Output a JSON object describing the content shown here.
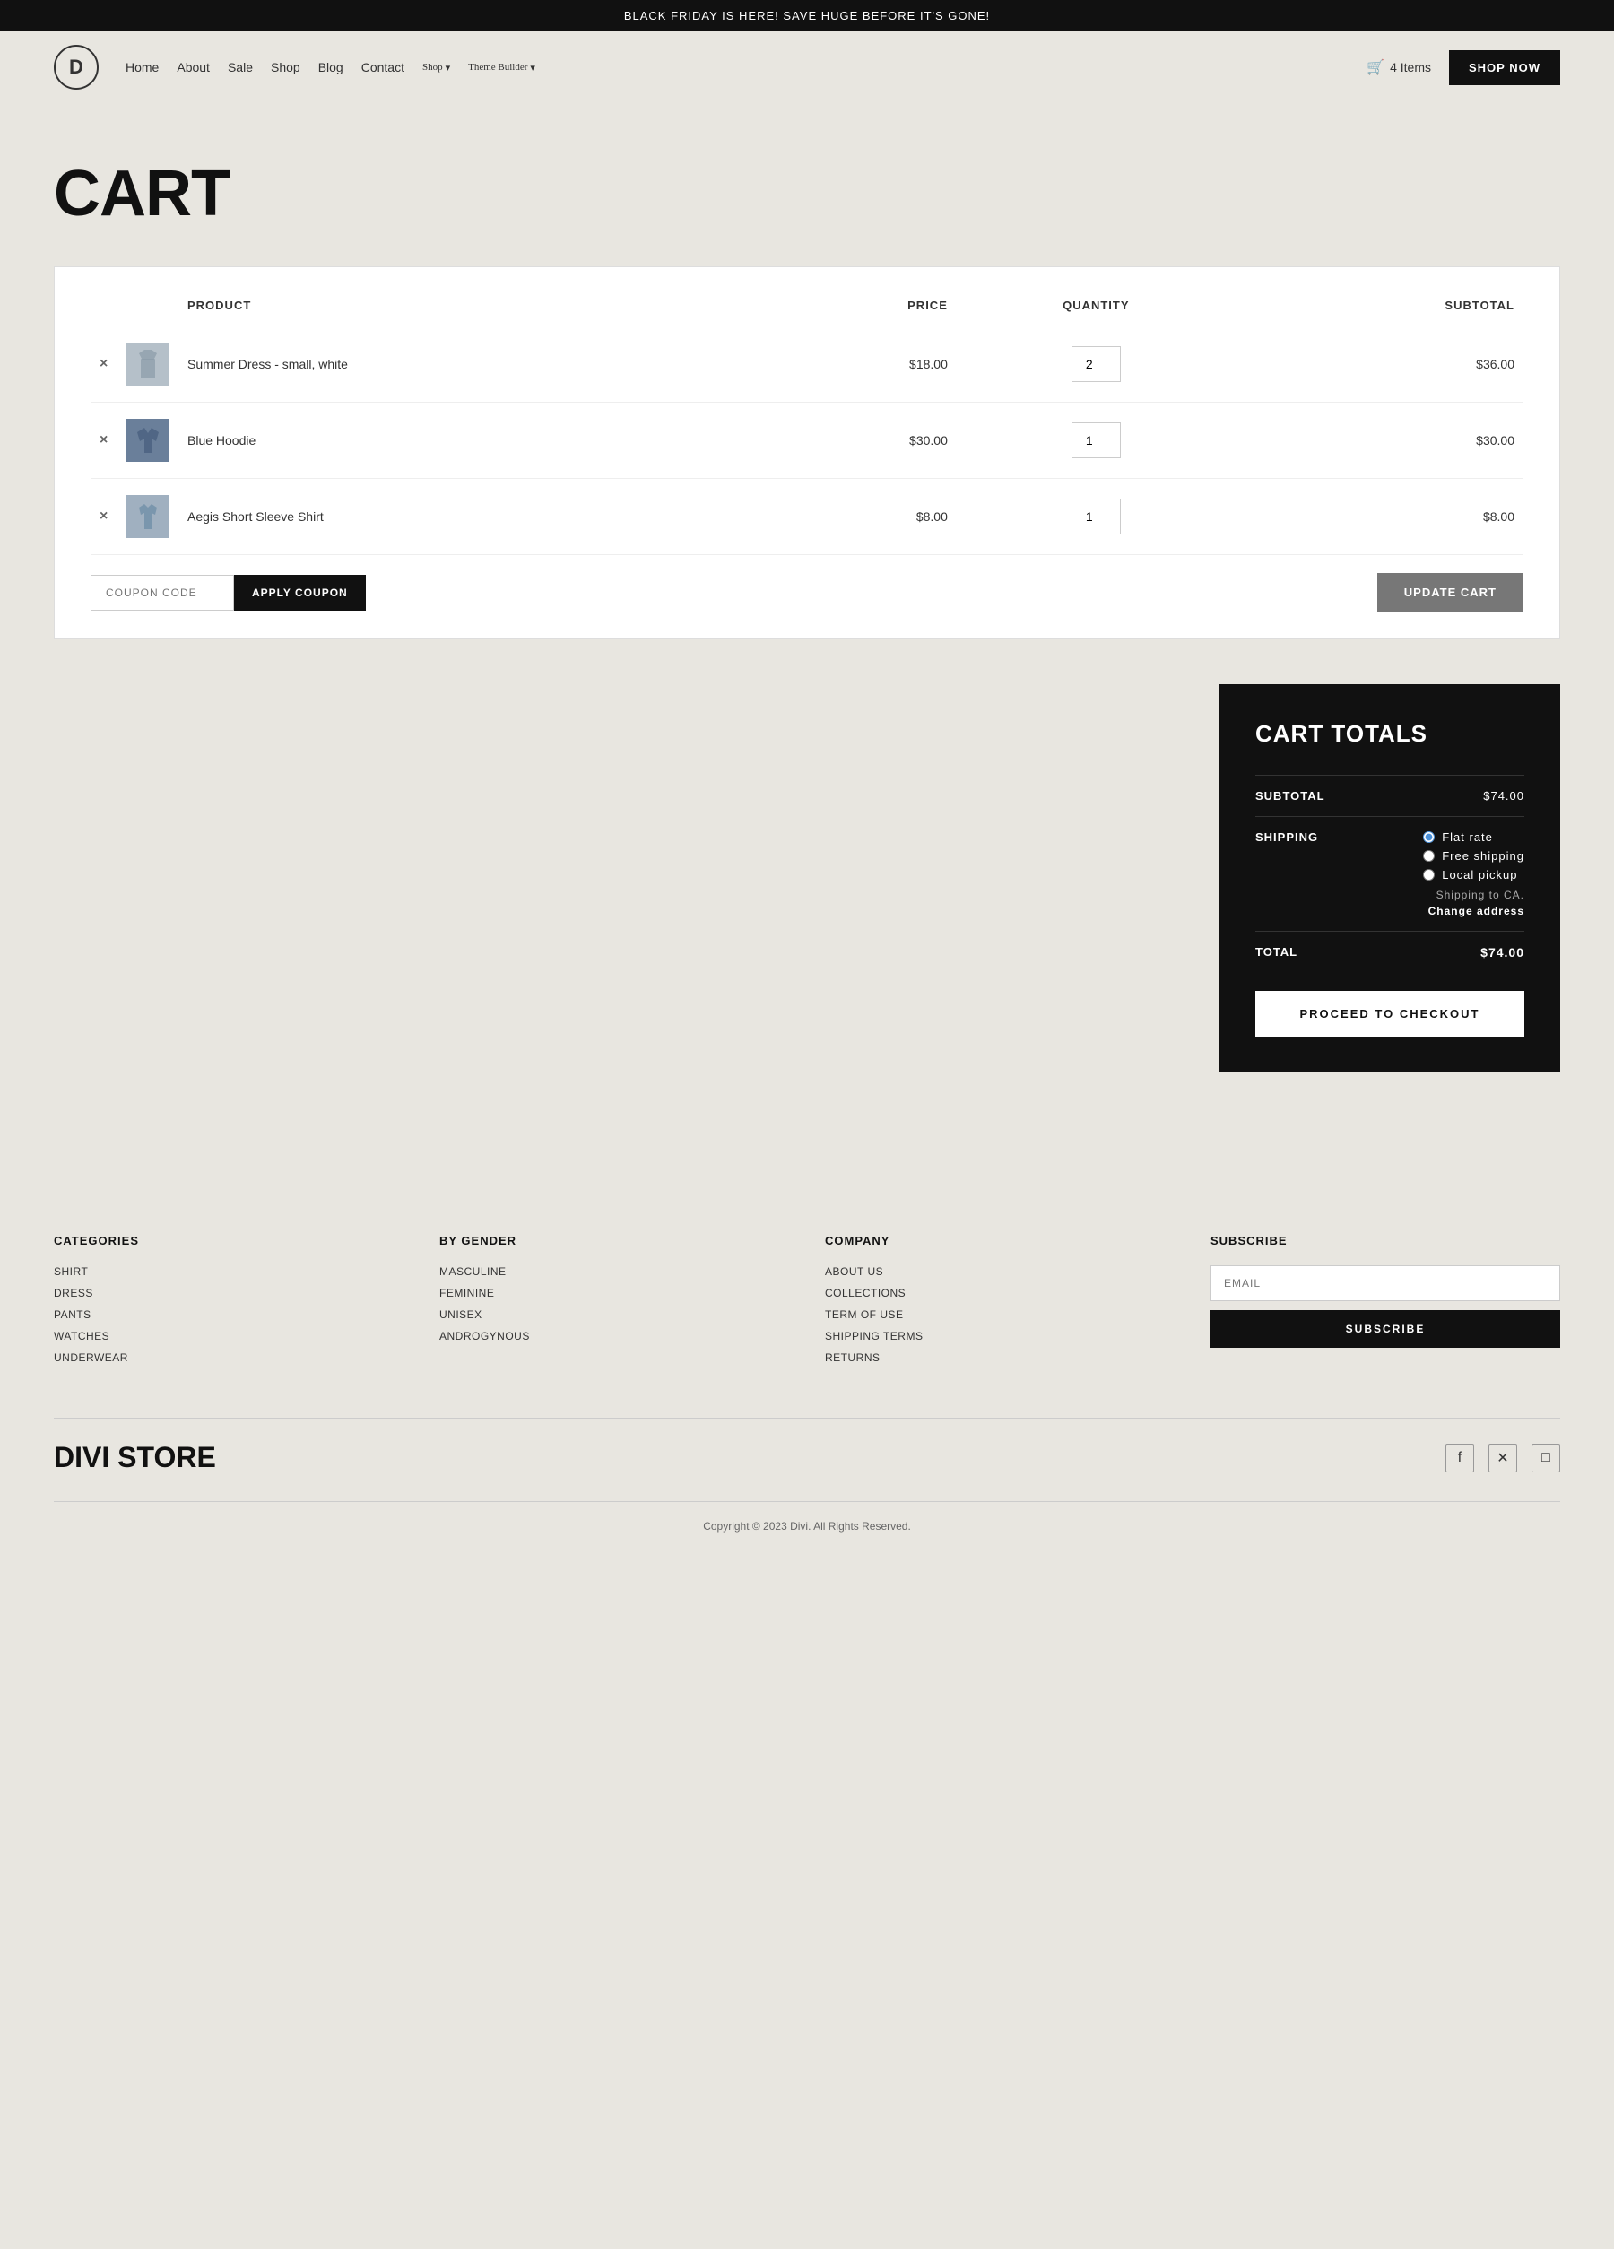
{
  "banner": {
    "text": "BLACK FRIDAY IS HERE! SAVE HUGE BEFORE IT'S GONE!"
  },
  "header": {
    "logo": "D",
    "nav": [
      {
        "label": "Home",
        "url": "#"
      },
      {
        "label": "About",
        "url": "#"
      },
      {
        "label": "Sale",
        "url": "#"
      },
      {
        "label": "Shop",
        "url": "#"
      },
      {
        "label": "Blog",
        "url": "#"
      },
      {
        "label": "Contact",
        "url": "#"
      },
      {
        "label": "Shop",
        "url": "#",
        "dropdown": true
      },
      {
        "label": "Theme Builder",
        "url": "#",
        "dropdown": true
      }
    ],
    "cart_label": "4 Items",
    "shop_now": "SHOP NOW"
  },
  "page": {
    "title": "CART"
  },
  "cart": {
    "columns": {
      "product": "PRODUCT",
      "price": "PRICE",
      "quantity": "QUANTITY",
      "subtotal": "SUBTOTAL"
    },
    "items": [
      {
        "name": "Summer Dress - small, white",
        "price": "$18.00",
        "quantity": 2,
        "subtotal": "$36.00",
        "img_class": "img-dress"
      },
      {
        "name": "Blue Hoodie",
        "price": "$30.00",
        "quantity": 1,
        "subtotal": "$30.00",
        "img_class": "img-hoodie"
      },
      {
        "name": "Aegis Short Sleeve Shirt",
        "price": "$8.00",
        "quantity": 1,
        "subtotal": "$8.00",
        "img_class": "img-shirt"
      }
    ],
    "coupon_placeholder": "COUPON CODE",
    "apply_coupon": "APPLY COUPON",
    "update_cart": "UPDATE CART"
  },
  "cart_totals": {
    "title": "CART TOTALS",
    "subtotal_label": "SUBTOTAL",
    "subtotal_value": "$74.00",
    "shipping_label": "SHIPPING",
    "shipping_options": [
      {
        "label": "Flat rate",
        "checked": true
      },
      {
        "label": "Free shipping",
        "checked": false
      },
      {
        "label": "Local pickup",
        "checked": false
      }
    ],
    "shipping_to": "Shipping to CA.",
    "change_address": "Change address",
    "total_label": "TOTAL",
    "total_value": "$74.00",
    "checkout_btn": "PROCEED TO CHECKOUT"
  },
  "footer": {
    "categories": {
      "title": "CATEGORIES",
      "links": [
        "SHIRT",
        "DRESS",
        "PANTS",
        "WATCHES",
        "UNDERWEAR"
      ]
    },
    "by_gender": {
      "title": "BY GENDER",
      "links": [
        "MASCULINE",
        "FEMININE",
        "UNISEX",
        "ANDROGYNOUS"
      ]
    },
    "company": {
      "title": "COMPANY",
      "links": [
        "ABOUT US",
        "COLLECTIONS",
        "TERM OF USE",
        "SHIPPING TERMS",
        "RETURNS"
      ]
    },
    "subscribe": {
      "title": "SUBSCRIBE",
      "email_placeholder": "EMAIL",
      "subscribe_btn": "SUBSCRIBE"
    },
    "brand": "DIVI STORE",
    "copyright": "Copyright © 2023 Divi. All Rights Reserved."
  }
}
